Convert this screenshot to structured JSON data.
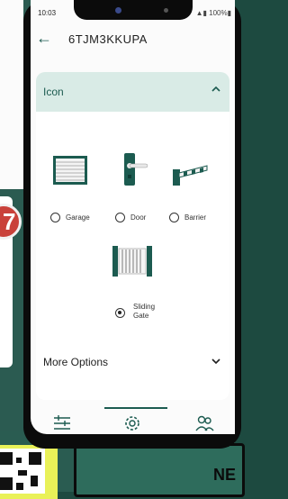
{
  "status_bar": {
    "time": "10:03",
    "right": "▲▮ 100%▮"
  },
  "app_bar": {
    "title": "6TJM3KKUPA"
  },
  "icon_section": {
    "header": "Icon",
    "options": [
      {
        "label": "Garage",
        "selected": false
      },
      {
        "label": "Door",
        "selected": false
      },
      {
        "label": "Barrier",
        "selected": false
      },
      {
        "label": "Sliding Gate",
        "label_line1": "Sliding",
        "label_line2": "Gate",
        "selected": true
      }
    ]
  },
  "more_options": {
    "label": "More Options"
  },
  "background": {
    "badge_text": "7",
    "panel_text": "NE"
  },
  "colors": {
    "accent": "#1c5b50",
    "section_header_bg": "#d9ebe6",
    "backdrop": "#1d4a40"
  },
  "bottom_nav": {
    "items": [
      "sliders-icon",
      "settings-gear-icon",
      "users-icon"
    ]
  }
}
